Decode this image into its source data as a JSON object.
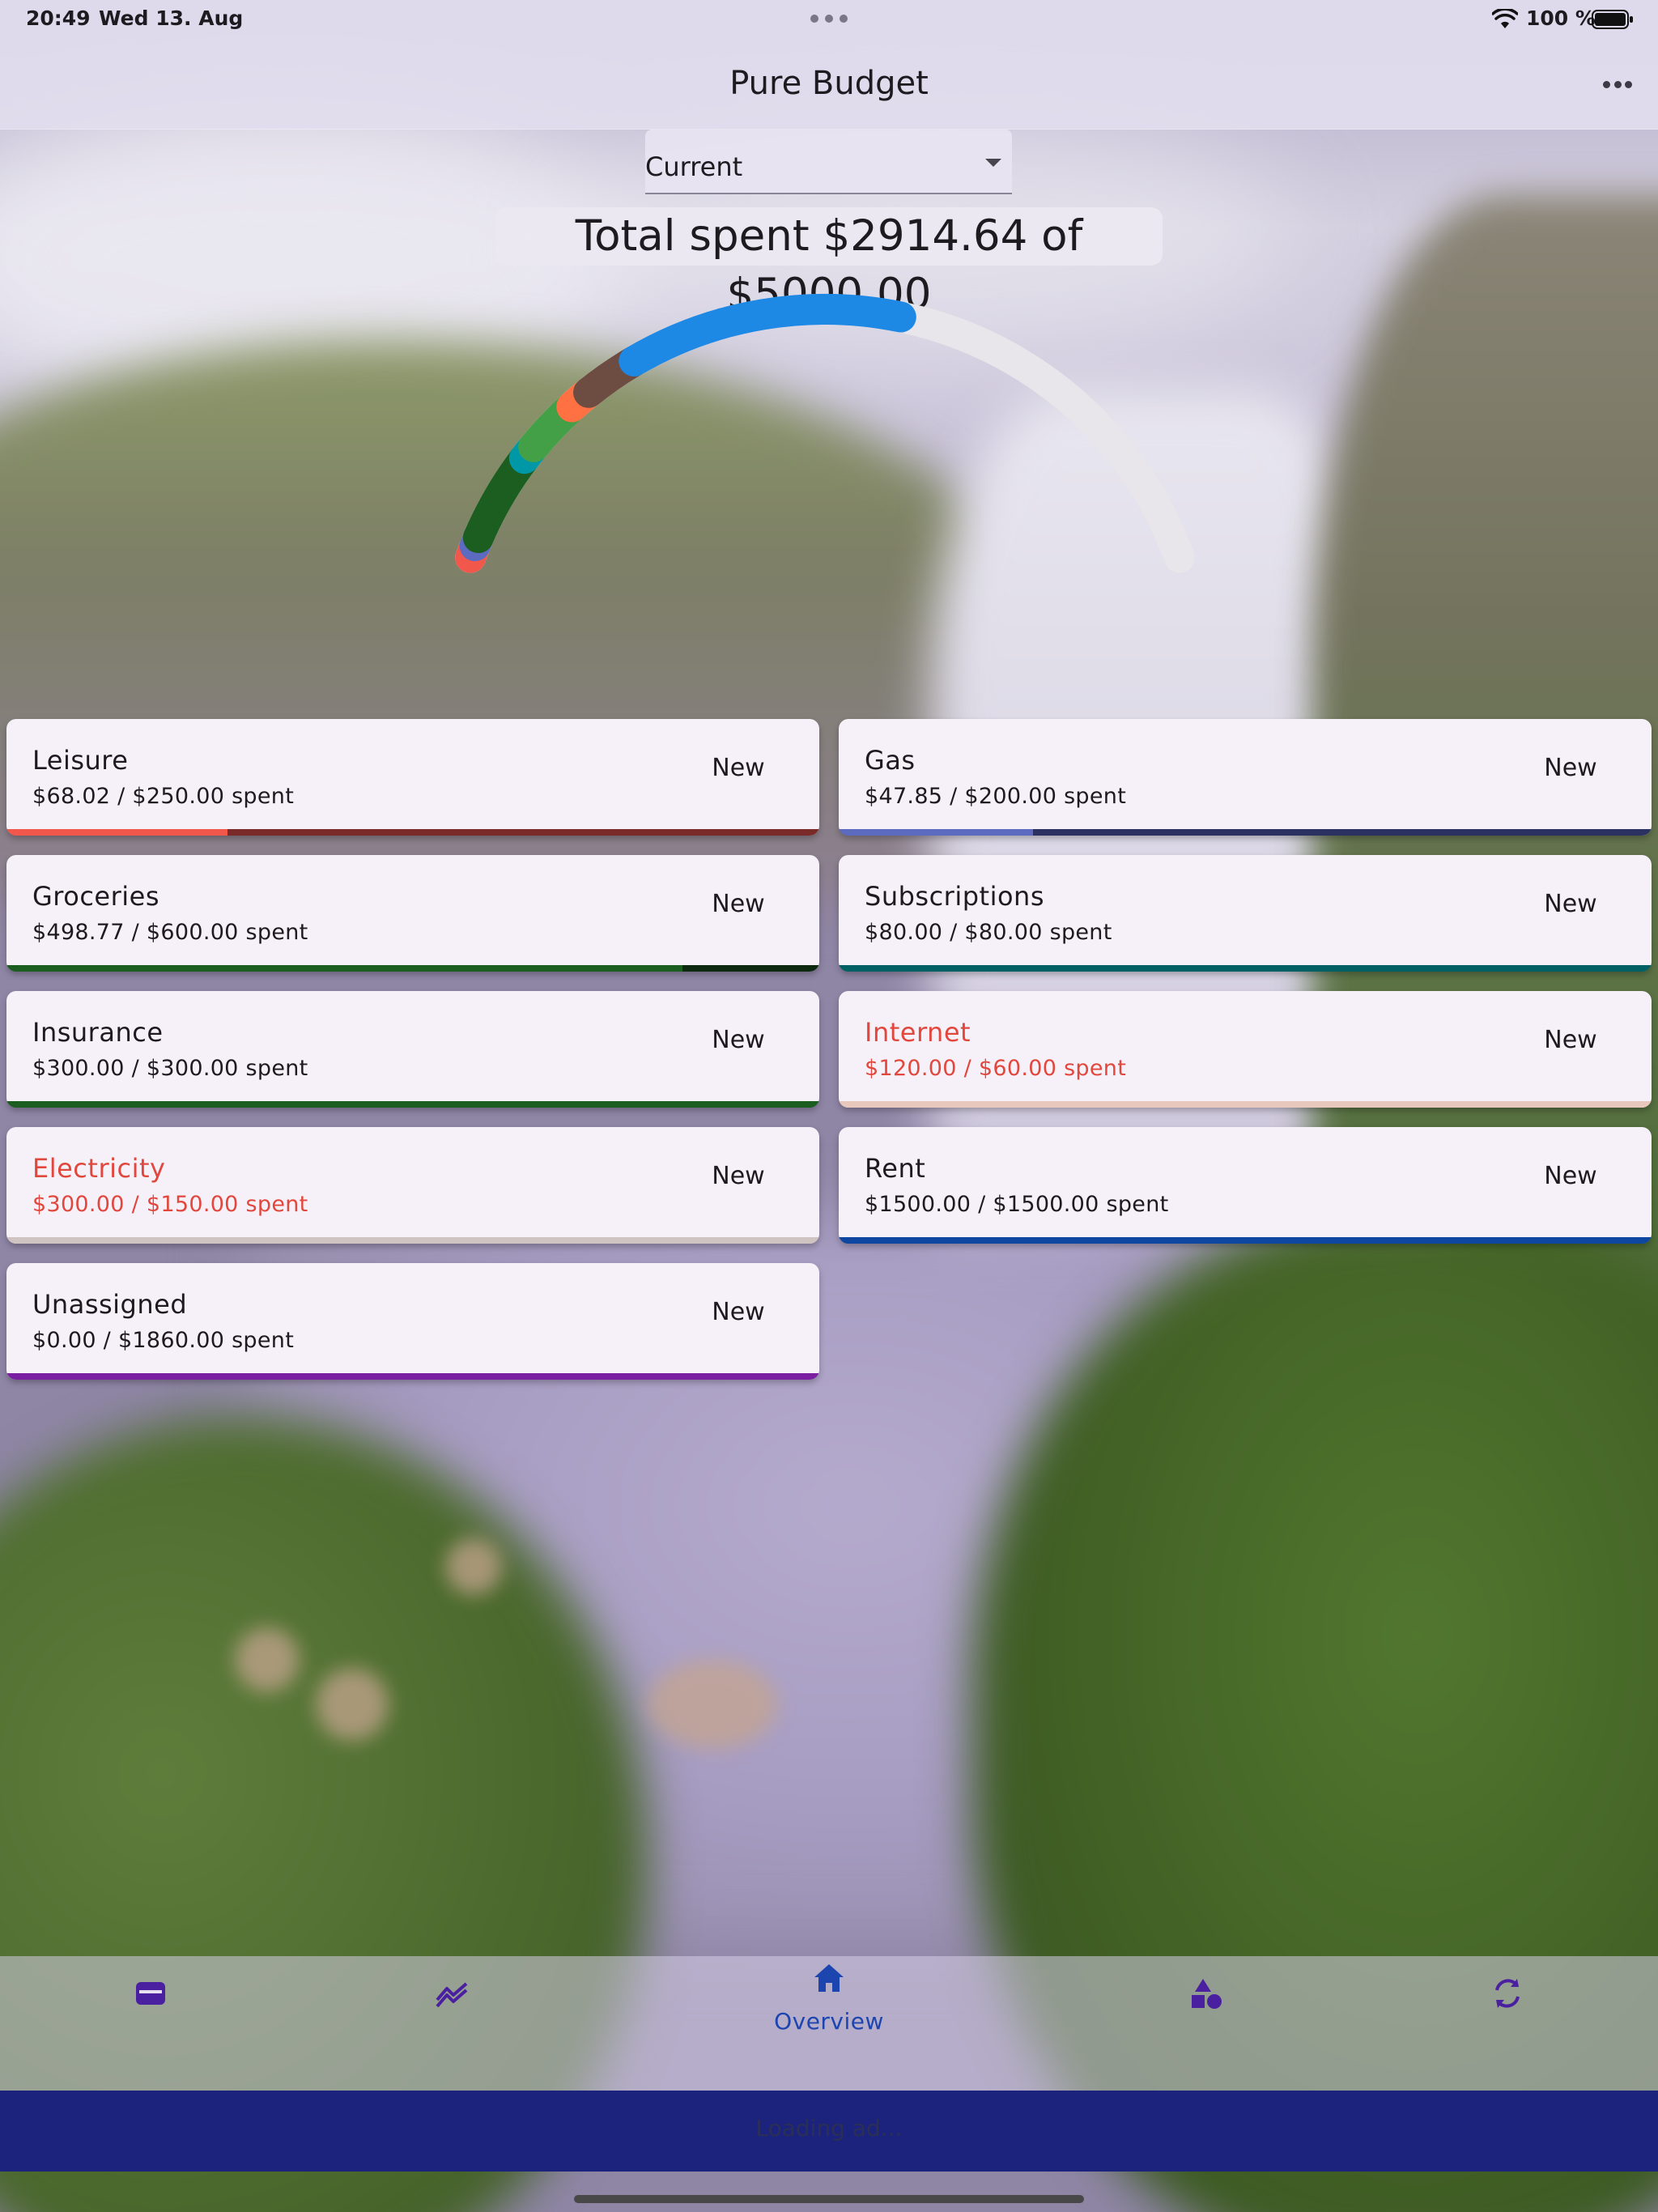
{
  "status_bar": {
    "time": "20:49",
    "date": "Wed 13. Aug",
    "battery": "100 %"
  },
  "app_bar": {
    "title": "Pure Budget"
  },
  "period_select": {
    "value": "Current"
  },
  "summary": {
    "total_text": "Total spent $2914.64 of $5000.00",
    "spent": 2914.64,
    "budget": 5000.0
  },
  "gauge": {
    "track_color": "#e0dde4",
    "segments": [
      {
        "name": "Leisure",
        "amount": 68.02,
        "color": "#f1584b"
      },
      {
        "name": "Gas",
        "amount": 47.85,
        "color": "#5c6bc0"
      },
      {
        "name": "Groceries",
        "amount": 498.77,
        "color": "#1b5e20"
      },
      {
        "name": "Subscriptions",
        "amount": 80.0,
        "color": "#0097a7"
      },
      {
        "name": "Insurance",
        "amount": 300.0,
        "color": "#43a047"
      },
      {
        "name": "Internet",
        "amount": 120.0,
        "color": "#ff7043"
      },
      {
        "name": "Electricity",
        "amount": 300.0,
        "color": "#6d4c41"
      },
      {
        "name": "Rent",
        "amount": 1500.0,
        "color": "#1e88e5"
      }
    ]
  },
  "categories": [
    {
      "name": "Leisure",
      "amount_text": "$68.02 / $250.00 spent",
      "spent": 68.02,
      "budget": 250.0,
      "over": false,
      "fill_color": "#f1584b",
      "track_color": "#7b2a2a",
      "new_label": "New"
    },
    {
      "name": "Gas",
      "amount_text": "$47.85 / $200.00 spent",
      "spent": 47.85,
      "budget": 200.0,
      "over": false,
      "fill_color": "#5c6bc0",
      "track_color": "#2b3160",
      "new_label": "New"
    },
    {
      "name": "Groceries",
      "amount_text": "$498.77 / $600.00 spent",
      "spent": 498.77,
      "budget": 600.0,
      "over": false,
      "fill_color": "#1b5e20",
      "track_color": "#0d2a10",
      "new_label": "New"
    },
    {
      "name": "Subscriptions",
      "amount_text": "$80.00 / $80.00 spent",
      "spent": 80.0,
      "budget": 80.0,
      "over": false,
      "fill_color": "#006064",
      "track_color": "#003035",
      "new_label": "New"
    },
    {
      "name": "Insurance",
      "amount_text": "$300.00 / $300.00 spent",
      "spent": 300.0,
      "budget": 300.0,
      "over": false,
      "fill_color": "#1b5e20",
      "track_color": "#0d2a10",
      "new_label": "New"
    },
    {
      "name": "Internet",
      "amount_text": "$120.00 / $60.00 spent",
      "spent": 120.0,
      "budget": 60.0,
      "over": true,
      "fill_color": "#e8c7bd",
      "track_color": "#e8c7bd",
      "new_label": "New"
    },
    {
      "name": "Electricity",
      "amount_text": "$300.00 / $150.00 spent",
      "spent": 300.0,
      "budget": 150.0,
      "over": true,
      "fill_color": "#cfc4c2",
      "track_color": "#cfc4c2",
      "new_label": "New"
    },
    {
      "name": "Rent",
      "amount_text": "$1500.00 / $1500.00 spent",
      "spent": 1500.0,
      "budget": 1500.0,
      "over": false,
      "fill_color": "#0d47a1",
      "track_color": "#06224e",
      "new_label": "New"
    },
    {
      "name": "Unassigned",
      "amount_text": "$0.00 / $1860.00 spent",
      "spent": 0.0,
      "budget": 1860.0,
      "over": false,
      "fill_color": "#7b1fa2",
      "track_color": "#7b1fa2",
      "new_label": "New"
    }
  ],
  "bottom_nav": {
    "items": [
      {
        "icon": "wallet-icon",
        "label": ""
      },
      {
        "icon": "trend-icon",
        "label": ""
      },
      {
        "icon": "home-icon",
        "label": "Overview"
      },
      {
        "icon": "categories-icon",
        "label": ""
      },
      {
        "icon": "sync-icon",
        "label": ""
      }
    ],
    "icon_color": "#4a1fa0",
    "active_color": "#1d45b0"
  },
  "ad_banner": {
    "text": "Loading ad..."
  }
}
